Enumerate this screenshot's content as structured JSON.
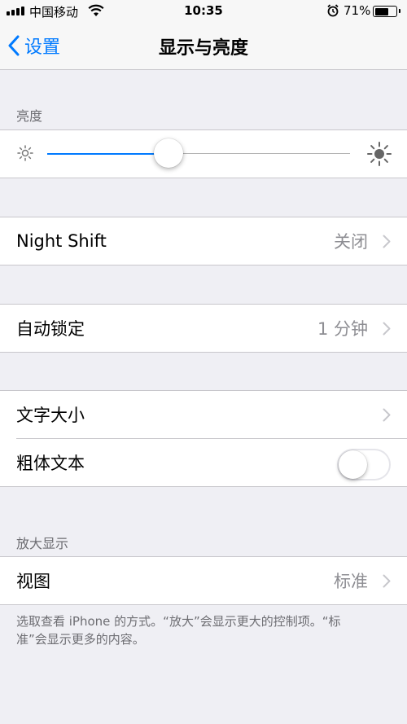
{
  "status_bar": {
    "carrier": "中国移动",
    "time": "10:35",
    "battery_percent_text": "71%",
    "battery_level": 0.71,
    "icons": [
      "signal-icon",
      "wifi-icon",
      "alarm-icon",
      "battery-icon"
    ]
  },
  "nav": {
    "back_label": "设置",
    "title": "显示与亮度"
  },
  "brightness": {
    "header": "亮度",
    "level": 0.4
  },
  "night_shift": {
    "label": "Night Shift",
    "value": "关闭"
  },
  "auto_lock": {
    "label": "自动锁定",
    "value": "1 分钟"
  },
  "text": {
    "text_size_label": "文字大小",
    "bold_text_label": "粗体文本",
    "bold_text_on": false
  },
  "zoom": {
    "header": "放大显示",
    "view_label": "视图",
    "view_value": "标准",
    "footer": "选取查看 iPhone 的方式。“放大”会显示更大的控制项。“标准”会显示更多的内容。"
  },
  "colors": {
    "accent": "#007aff",
    "background": "#efeff4",
    "secondary_text": "#8e8e93"
  }
}
